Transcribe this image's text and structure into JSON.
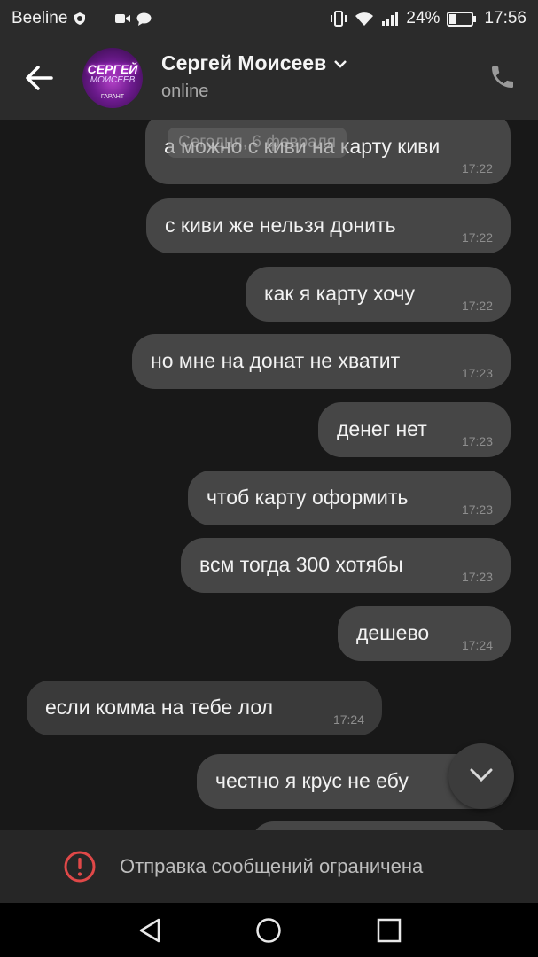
{
  "status_bar": {
    "carrier": "Beeline",
    "battery": "24%",
    "time": "17:56"
  },
  "header": {
    "contact_name": "Сергей Моисеев",
    "status": "online",
    "avatar_text_1": "СЕРГЕЙ",
    "avatar_text_2": "МОИСЕЕВ",
    "avatar_text_3": "ГАРАНТ"
  },
  "date_badge": "Сегодня, 6 февраля",
  "messages": [
    {
      "text": "а можно с киви на карту киви",
      "time": "17:22",
      "dir": "out"
    },
    {
      "text": "с киви же нельзя донить",
      "time": "17:22",
      "dir": "out"
    },
    {
      "text": "как я карту хочу",
      "time": "17:22",
      "dir": "out"
    },
    {
      "text": "но мне на донат не хватит",
      "time": "17:23",
      "dir": "out"
    },
    {
      "text": "денег нет",
      "time": "17:23",
      "dir": "out"
    },
    {
      "text": "чтоб карту оформить",
      "time": "17:23",
      "dir": "out"
    },
    {
      "text": "всм тогда 300 хотябы",
      "time": "17:23",
      "dir": "out"
    },
    {
      "text": "дешево",
      "time": "17:24",
      "dir": "out"
    },
    {
      "text": "если комма на тебе лол",
      "time": "17:24",
      "dir": "in"
    },
    {
      "text": "честно я крус не ебу",
      "time": "",
      "dir": "out"
    }
  ],
  "restriction": {
    "label": "Отправка сообщений ограничена"
  },
  "colors": {
    "bubble_out": "#464646",
    "bubble_in": "#3a3a3a",
    "alert": "#e04848"
  }
}
